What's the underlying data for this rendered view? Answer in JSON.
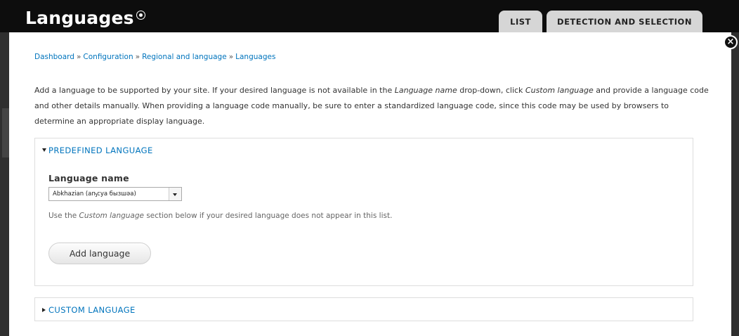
{
  "header": {
    "title": "Languages",
    "tabs": [
      {
        "label": "LIST"
      },
      {
        "label": "DETECTION AND SELECTION"
      }
    ]
  },
  "breadcrumb": {
    "items": [
      "Dashboard",
      "Configuration",
      "Regional and language",
      "Languages"
    ],
    "separator": "»"
  },
  "help": {
    "p1": "Add a language to be supported by your site. If your desired language is not available in the ",
    "em1": "Language name",
    "p2": " drop-down, click ",
    "em2": "Custom language",
    "p3": " and provide a language code and other details manually. When providing a language code manually, be sure to enter a standardized language code, since this code may be used by browsers to determine an appropriate display language."
  },
  "predefined": {
    "legend": "PREDEFINED LANGUAGE",
    "field_label": "Language name",
    "selected_value": "Abkhazian (аҧсуа бызшәа)",
    "desc_pre": "Use the ",
    "desc_em": "Custom language",
    "desc_post": " section below if your desired language does not appear in this list.",
    "button_label": "Add language"
  },
  "custom": {
    "legend": "CUSTOM LANGUAGE"
  },
  "icons": {
    "close": "close-icon",
    "shortcut": "add-shortcut-icon"
  },
  "colors": {
    "header_bg": "#0d0d0d",
    "link": "#0074bd",
    "tab_bg": "#d6d6d6"
  }
}
